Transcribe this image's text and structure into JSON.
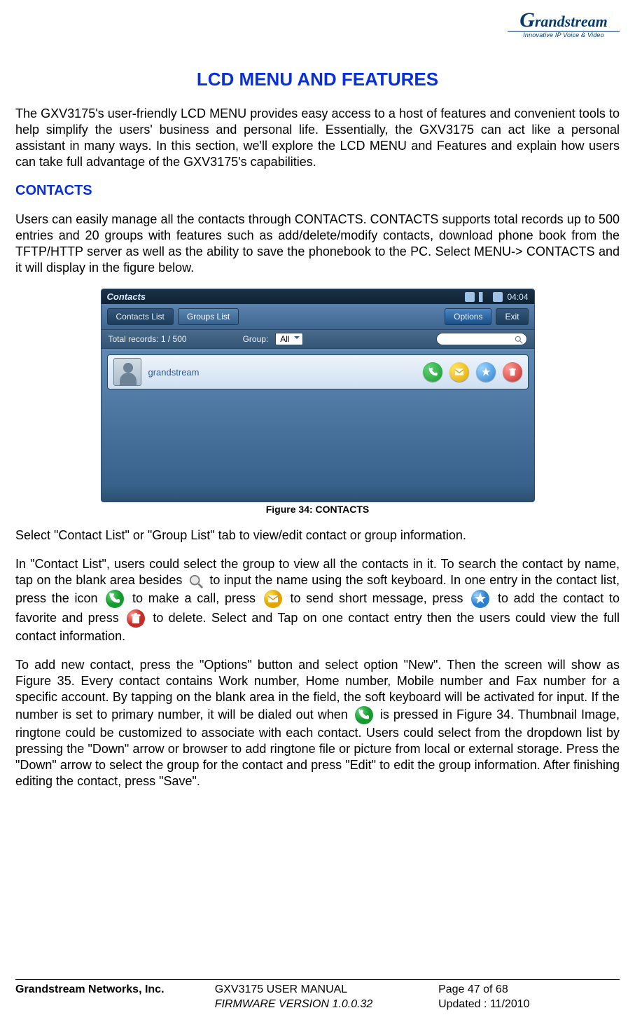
{
  "logo": {
    "brand": "Grandstream",
    "tagline": "Innovative IP Voice & Video"
  },
  "title": "LCD MENU AND FEATURES",
  "intro": "The GXV3175's user-friendly LCD MENU provides easy access to a host of features and convenient tools to help simplify the users' business and personal life. Essentially, the GXV3175 can act like a personal assistant in many ways. In this section, we'll explore the LCD MENU and Features and explain how users can take full advantage of the GXV3175's capabilities.",
  "section_contacts": "CONTACTS",
  "contacts_intro": "Users can easily manage all the contacts through CONTACTS. CONTACTS supports total records up to 500 entries and 20 groups with features such as add/delete/modify contacts, download phone book from the TFTP/HTTP server as well as the ability to save the phonebook to the PC. Select MENU-> CONTACTS and it will display in the figure below.",
  "figure": {
    "caption": "Figure 34: CONTACTS",
    "window_title": "Contacts",
    "clock": "04:04",
    "tabs": {
      "contacts_list": "Contacts List",
      "groups_list": "Groups List"
    },
    "buttons": {
      "options": "Options",
      "exit": "Exit"
    },
    "filter": {
      "total_label": "Total records: 1 / 500",
      "group_label": "Group:",
      "group_value": "All"
    },
    "row": {
      "name": "grandstream"
    }
  },
  "para_select_tab": "Select \"Contact List\" or \"Group List\" tab to view/edit contact or group information.",
  "p3a": "In \"Contact List\", users could select the group to view all the contacts in it. To search the contact by name, tap on the blank area besides ",
  "p3b": " to input the name using the soft keyboard. In one entry in the contact list, press the icon ",
  "p3c": " to make a call, press ",
  "p3d": " to send short message, press ",
  "p3e": " to add the contact to favorite and press ",
  "p3f": " to delete. Select and Tap on one contact entry then the users could view the full contact information.",
  "p4a": "To add new contact, press the \"Options\" button and select option \"New\". Then the screen will show as Figure 35. Every contact contains Work number, Home number, Mobile number and Fax number for a specific account. By tapping on the blank area in the field, the soft keyboard will be activated for input. If the number is set to primary number, it will be dialed out when ",
  "p4b": " is pressed in Figure 34. Thumbnail Image, ringtone could be customized to associate with each contact. Users could select from the dropdown list by pressing the \"Down\" arrow or browser to add ringtone file or picture from local or external storage. Press the \"Down\" arrow to select the group for the contact and press \"Edit\" to edit the group information. After finishing editing the contact, press \"Save\".",
  "footer": {
    "company": "Grandstream Networks, Inc.",
    "doc_title": "GXV3175 USER MANUAL",
    "fw": "FIRMWARE VERSION 1.0.0.32",
    "page": "Page 47 of 68",
    "updated": "Updated : 11/2010"
  }
}
